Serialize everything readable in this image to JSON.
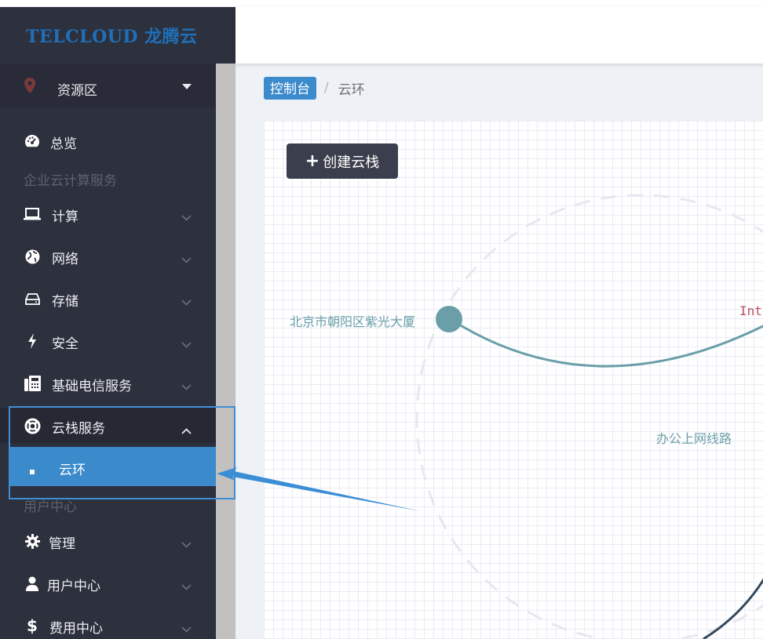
{
  "brand": {
    "logo_text": "TELCLOUD 龙腾云"
  },
  "region": {
    "label": "资源区"
  },
  "sidebar": {
    "overview": "总览",
    "section_enterprise": "企业云计算服务",
    "items": [
      {
        "label": "计算",
        "icon": "laptop-icon"
      },
      {
        "label": "网络",
        "icon": "globe-icon"
      },
      {
        "label": "存储",
        "icon": "hdd-icon"
      },
      {
        "label": "安全",
        "icon": "bolt-icon"
      },
      {
        "label": "基础电信服务",
        "icon": "fax-icon"
      },
      {
        "label": "云栈服务",
        "icon": "life-ring-icon"
      }
    ],
    "sub_active": "云环",
    "section_user": "用户中心",
    "items2": [
      {
        "label": "管理",
        "icon": "gear-icon"
      },
      {
        "label": "用户中心",
        "icon": "user-icon"
      },
      {
        "label": "费用中心",
        "icon": "dollar-icon"
      }
    ]
  },
  "breadcrumb": {
    "home": "控制台",
    "separator": "/",
    "current": "云环"
  },
  "canvas": {
    "create_button": "创建云栈",
    "node_label": "北京市朝阳区紫光大厦",
    "link_label": "办公上网线路",
    "inter_label": "Inte"
  },
  "colors": {
    "sidebar_bg": "#2d303d",
    "accent": "#3b8acb",
    "node": "#6a9fa9",
    "link_dark": "#34495e"
  }
}
